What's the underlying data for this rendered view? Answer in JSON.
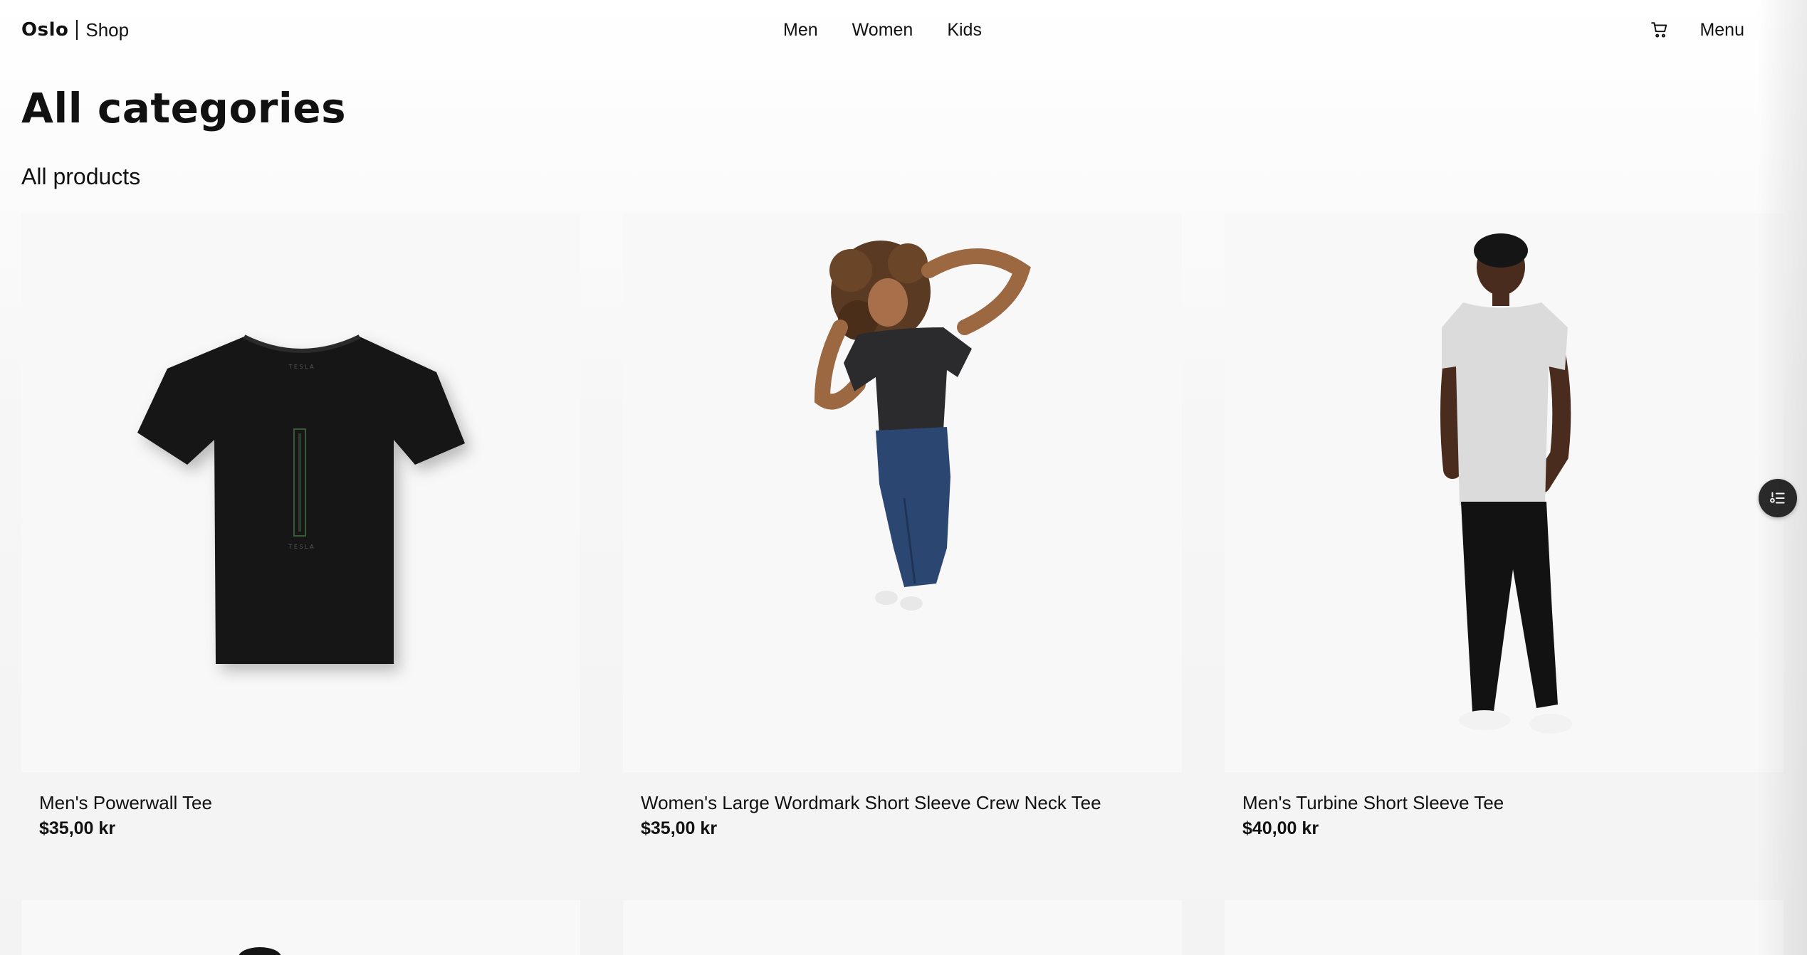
{
  "header": {
    "brand_name": "Oslo",
    "brand_sub": "Shop",
    "nav": [
      "Men",
      "Women",
      "Kids"
    ],
    "cart_icon": "cart-icon",
    "menu_label": "Menu"
  },
  "main": {
    "title": "All categories",
    "section_title": "All products",
    "products": [
      {
        "name": "Men's Powerwall Tee",
        "price": "$35,00 kr",
        "image": "black-tshirt"
      },
      {
        "name": "Women's Large Wordmark Short Sleeve Crew Neck Tee",
        "price": "$35,00 kr",
        "image": "woman-jumping-black-tee-jeans"
      },
      {
        "name": "Men's Turbine Short Sleeve Tee",
        "price": "$40,00 kr",
        "image": "man-standing-white-tee"
      }
    ]
  },
  "floating_button": {
    "icon": "filter-settings-icon"
  },
  "colors": {
    "text": "#111111",
    "card_bg": "#f8f8f8",
    "page_bg": "#f4f4f4",
    "float_btn": "#2a2a2a"
  }
}
